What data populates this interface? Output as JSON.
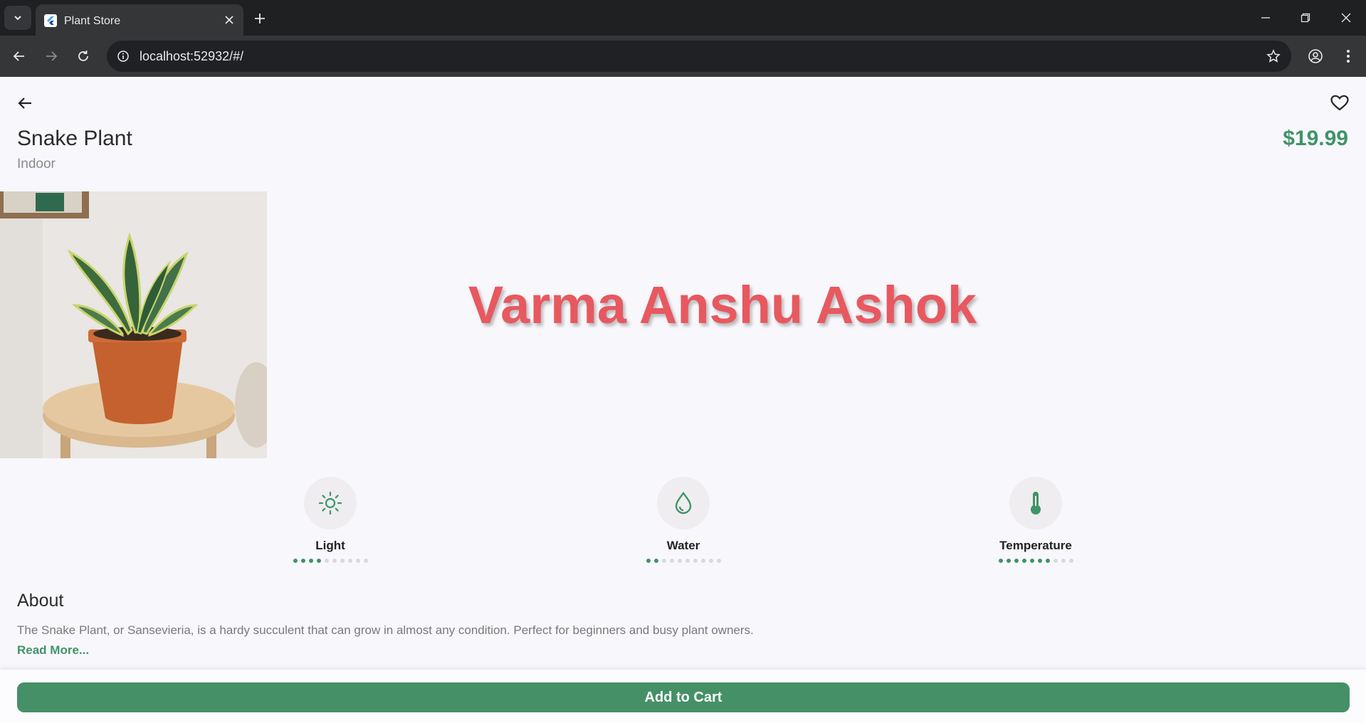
{
  "browser": {
    "tab_title": "Plant Store",
    "url": "localhost:52932/#/"
  },
  "product": {
    "name": "Snake Plant",
    "category": "Indoor",
    "price": "$19.99",
    "watermark": "Varma Anshu Ashok"
  },
  "care": [
    {
      "label": "Light",
      "icon": "sun-icon",
      "level": 4,
      "max": 10
    },
    {
      "label": "Water",
      "icon": "water-drop-icon",
      "level": 2,
      "max": 10
    },
    {
      "label": "Temperature",
      "icon": "thermometer-icon",
      "level": 7,
      "max": 10
    }
  ],
  "about": {
    "heading": "About",
    "text": "The Snake Plant, or Sansevieria, is a hardy succulent that can grow in almost any condition. Perfect for beginners and busy plant owners.",
    "read_more": "Read More..."
  },
  "cart": {
    "label": "Add to Cart"
  },
  "colors": {
    "accent": "#3f9468",
    "button": "#459067",
    "watermark": "#e8585f"
  }
}
